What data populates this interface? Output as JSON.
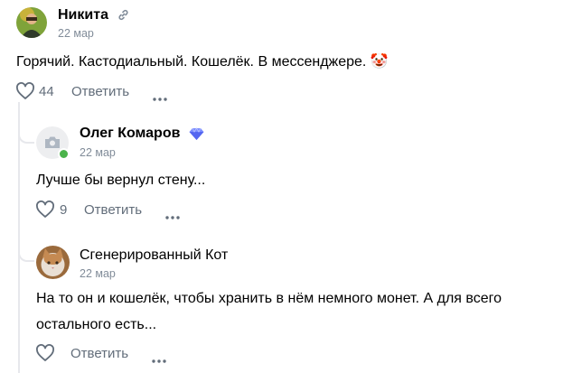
{
  "comments": [
    {
      "author": "Никита",
      "date": "22 мар",
      "text": "Горячий. Кастодиальный. Кошелёк. В мессенджере. 🤡",
      "likes": "44",
      "reply_label": "Ответить"
    },
    {
      "author": "Олег Комаров",
      "date": "22 мар",
      "text": "Лучше бы вернул стену...",
      "likes": "9",
      "reply_label": "Ответить"
    },
    {
      "author": "Сгенерированный Кот",
      "date": "22 мар",
      "text_line1": "На то он и кошелёк, чтобы хранить в нём немного монет. А для всего",
      "text_line2": "остального есть...",
      "reply_label": "Ответить"
    }
  ],
  "colors": {
    "accent_blue": "#2688eb",
    "muted": "#818c99",
    "online": "#4bb34b"
  },
  "icons": [
    "link-icon",
    "heart-icon",
    "more-icon",
    "verified-gem-icon",
    "camera-placeholder-icon"
  ]
}
